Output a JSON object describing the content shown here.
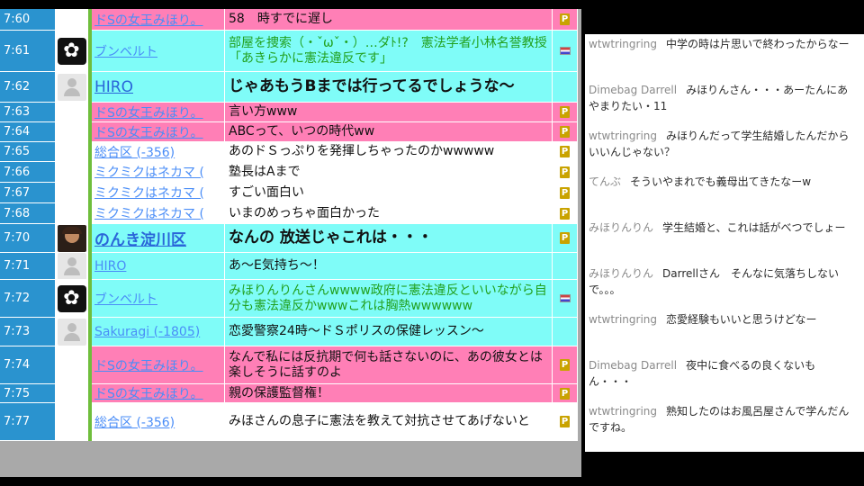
{
  "comment_rows": [
    {
      "time": "7:60",
      "name": "ドSの女王みほり。",
      "message": "58　時すでに遅し",
      "bg": "pink",
      "name_style": "link",
      "msg_style": "black",
      "avatar": "none",
      "icon": "premium-icon"
    },
    {
      "time": "7:61",
      "name": "ブンベルト",
      "message": "部屋を捜索（・ˇωˇ・）…ダﾄ!?　憲法学者小林名誉教授「あきらかに憲法違反です」",
      "bg": "cyan",
      "name_style": "link",
      "msg_style": "green",
      "avatar": "dark",
      "icon": "flag-icon"
    },
    {
      "time": "7:62",
      "name": "HIRO",
      "message": "じゃあもうBまでは行ってるでしょうな～",
      "bg": "cyan",
      "name_style": "blue",
      "msg_style": "bold",
      "avatar": "person",
      "icon": "none"
    },
    {
      "time": "7:63",
      "name": "ドSの女王みほり。",
      "message": "言い方www",
      "bg": "pink",
      "name_style": "link",
      "msg_style": "black",
      "avatar": "none",
      "icon": "premium-icon"
    },
    {
      "time": "7:64",
      "name": "ドSの女王みほり。",
      "message": "ABCって、いつの時代ww",
      "bg": "pink",
      "name_style": "link",
      "msg_style": "black",
      "avatar": "none",
      "icon": "premium-icon"
    },
    {
      "time": "7:65",
      "name": "総合区 (-356)",
      "message": "あのドＳっぷりを発揮しちゃったのかwwwww",
      "bg": "white",
      "name_style": "link",
      "msg_style": "black",
      "avatar": "none",
      "icon": "premium-icon"
    },
    {
      "time": "7:66",
      "name": "ミクミクはネカマ (",
      "message": "塾長はAまで",
      "bg": "white",
      "name_style": "link",
      "msg_style": "black",
      "avatar": "none",
      "icon": "premium-icon"
    },
    {
      "time": "7:67",
      "name": "ミクミクはネカマ (",
      "message": "すごい面白い",
      "bg": "white",
      "name_style": "link",
      "msg_style": "black",
      "avatar": "none",
      "icon": "premium-icon"
    },
    {
      "time": "7:68",
      "name": "ミクミクはネカマ (",
      "message": "いまのめっちゃ面白かった",
      "bg": "white",
      "name_style": "link",
      "msg_style": "black",
      "avatar": "none",
      "icon": "premium-icon"
    },
    {
      "time": "7:70",
      "name": "のんき淀川区",
      "message": "なんの 放送じゃこれは・・・",
      "bg": "cyan",
      "name_style": "blue-bold",
      "msg_style": "bold",
      "avatar": "photo",
      "icon": "premium-icon"
    },
    {
      "time": "7:71",
      "name": "HIRO",
      "message": "あ～E気持ち～！",
      "bg": "cyan",
      "name_style": "link",
      "msg_style": "black",
      "avatar": "person",
      "icon": "none"
    },
    {
      "time": "7:72",
      "name": "ブンベルト",
      "message": "みほりんりんさんwwww政府に憲法違反といいながら自分も憲法違反かwwwこれは胸熱wwwwww",
      "bg": "cyan",
      "name_style": "link",
      "msg_style": "green",
      "avatar": "dark",
      "icon": "flag-icon"
    },
    {
      "time": "7:73",
      "name": "Sakuragi (-1805)",
      "message": "恋愛警察24時～ドＳポリスの保健レッスン～",
      "bg": "cyan",
      "name_style": "link",
      "msg_style": "black",
      "avatar": "person",
      "icon": "none"
    },
    {
      "time": "7:74",
      "name": "ドSの女王みほり。",
      "message": "なんで私には反抗期で何も話さないのに、あの彼女とは楽しそうに話すのよ",
      "bg": "pink",
      "name_style": "link",
      "msg_style": "black",
      "avatar": "none",
      "icon": "premium-icon"
    },
    {
      "time": "7:75",
      "name": "ドSの女王みほり。",
      "message": "親の保護監督権！",
      "bg": "pink",
      "name_style": "link",
      "msg_style": "black",
      "avatar": "none",
      "icon": "premium-icon"
    },
    {
      "time": "7:77",
      "name": "総合区 (-356)",
      "message": "みほさんの息子に憲法を教えて対抗させてあげないと",
      "bg": "white",
      "name_style": "link",
      "msg_style": "black",
      "avatar": "none",
      "icon": "premium-icon"
    }
  ],
  "side_comments": [
    {
      "author": "wtwtringring",
      "text": "中学の時は片思いで終わったからなー"
    },
    {
      "author": "Dimebag Darrell",
      "text": "みほりんさん・・・あーたんにあやまりたい・11"
    },
    {
      "author": "wtwtringring",
      "text": "みほりんだって学生結婚したんだからいいんじゃない？"
    },
    {
      "author": "てんぶ",
      "text": "そういやまれでも義母出てきたなーw"
    },
    {
      "author": "みほりんりん",
      "text": "学生結婚と、これは話がべつでしょー"
    },
    {
      "author": "みほりんりん",
      "text": "Darrellさん　そんなに気落ちしないで。。。"
    },
    {
      "author": "wtwtringring",
      "text": "恋愛経験もいいと思うけどなー"
    },
    {
      "author": "Dimebag Darrell",
      "text": "夜中に食べるの良くないもん・・・"
    },
    {
      "author": "wtwtringring",
      "text": "熟知したのはお風呂屋さんで学んだんですね。"
    }
  ],
  "premium_glyph": "P",
  "colors": {
    "pink": "#ff7fb6",
    "cyan": "#7ffcf8",
    "time_blue": "#2a93cf",
    "name_link": "#4a8df7",
    "green_text": "#22a11f"
  }
}
